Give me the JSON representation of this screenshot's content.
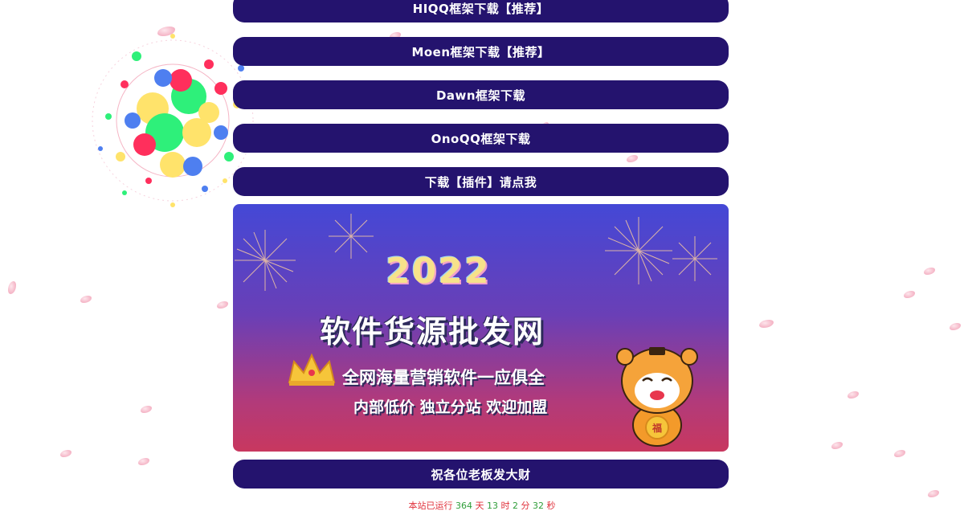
{
  "buttons": [
    {
      "label": "HIQQ框架下载【推荐】"
    },
    {
      "label": "Moen框架下载【推荐】"
    },
    {
      "label": "Dawn框架下载"
    },
    {
      "label": "OnoQQ框架下载"
    },
    {
      "label": "下载【插件】请点我"
    }
  ],
  "banner": {
    "year": "2022",
    "title": "软件货源批发网",
    "subtitle": "全网海量营销软件一应俱全",
    "tagline": "内部低价 独立分站 欢迎加盟",
    "mascot_badge": "福"
  },
  "bottom_button": {
    "label": "祝各位老板发大财"
  },
  "runtime": {
    "prefix": "本站已运行",
    "days": "364",
    "days_unit": "天",
    "hours": "13",
    "hours_unit": "时",
    "minutes": "2",
    "minutes_unit": "分",
    "seconds": "32",
    "seconds_unit": "秒"
  },
  "colors": {
    "button_bg": "#24136e",
    "banner_top": "#4448d6",
    "banner_bottom": "#c8385f",
    "runtime_red": "#e0303a"
  }
}
